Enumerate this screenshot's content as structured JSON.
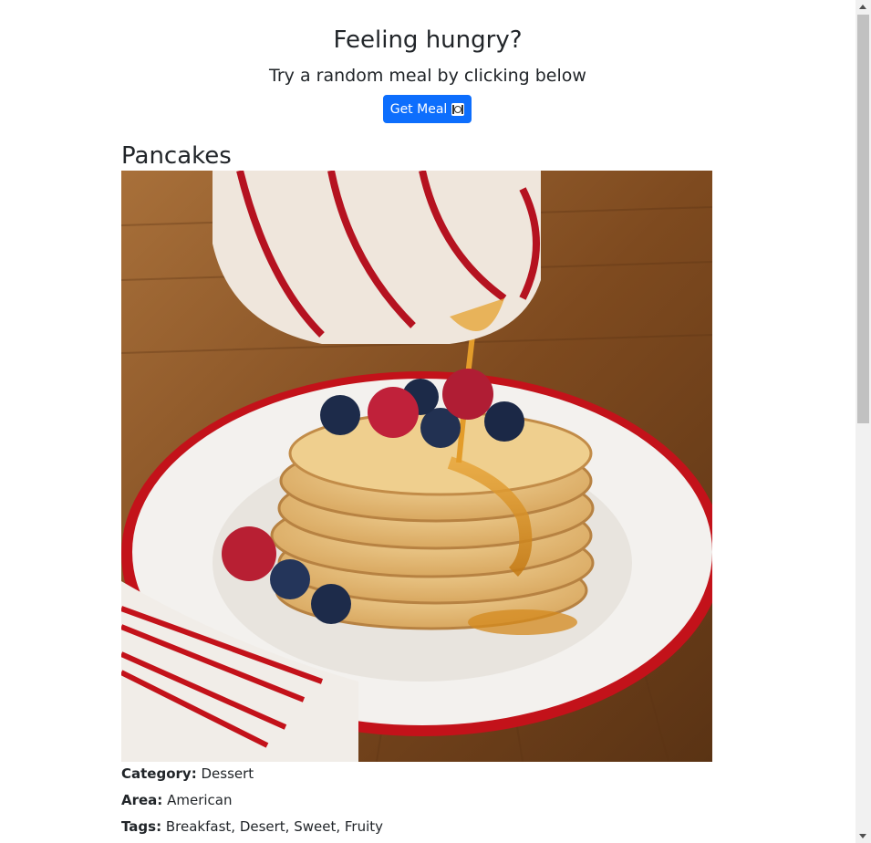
{
  "hero": {
    "title": "Feeling hungry?",
    "subtitle": "Try a random meal by clicking below",
    "button_label": "Get Meal",
    "button_icon": "plate-with-cutlery-icon"
  },
  "meal": {
    "name": "Pancakes",
    "image_alt": "Pancakes",
    "details": [
      {
        "label": "Category:",
        "value": "Dessert"
      },
      {
        "label": "Area:",
        "value": "American"
      },
      {
        "label": "Tags:",
        "value": "Breakfast, Desert, Sweet, Fruity"
      }
    ]
  },
  "colors": {
    "primary_button": "#0d6efd",
    "text": "#212529"
  }
}
